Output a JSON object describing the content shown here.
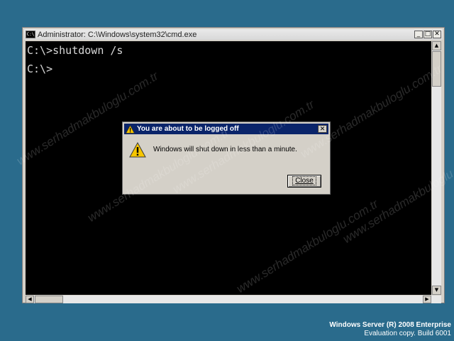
{
  "window": {
    "title": "Administrator: C:\\Windows\\system32\\cmd.exe",
    "icon_text": "C:\\",
    "minimize": "_",
    "maximize": "□",
    "close": "✕"
  },
  "console": {
    "lines": [
      "C:\\>shutdown /s",
      "C:\\>"
    ]
  },
  "dialog": {
    "title": "You are about to be logged off",
    "message": "Windows will shut down in less than a minute.",
    "close_button": "Close",
    "close_glyph": "✕"
  },
  "scroll": {
    "up": "▲",
    "down": "▼",
    "left": "◀",
    "right": "▶"
  },
  "footer": {
    "product": "Windows Server (R) 2008 Enterprise",
    "build": "Evaluation copy. Build 6001"
  },
  "watermark": "www.serhadmakbuloglu.com.tr",
  "colors": {
    "desktop": "#2a6b8c",
    "console_bg": "#000000",
    "dialog_title": "#0a246a"
  }
}
